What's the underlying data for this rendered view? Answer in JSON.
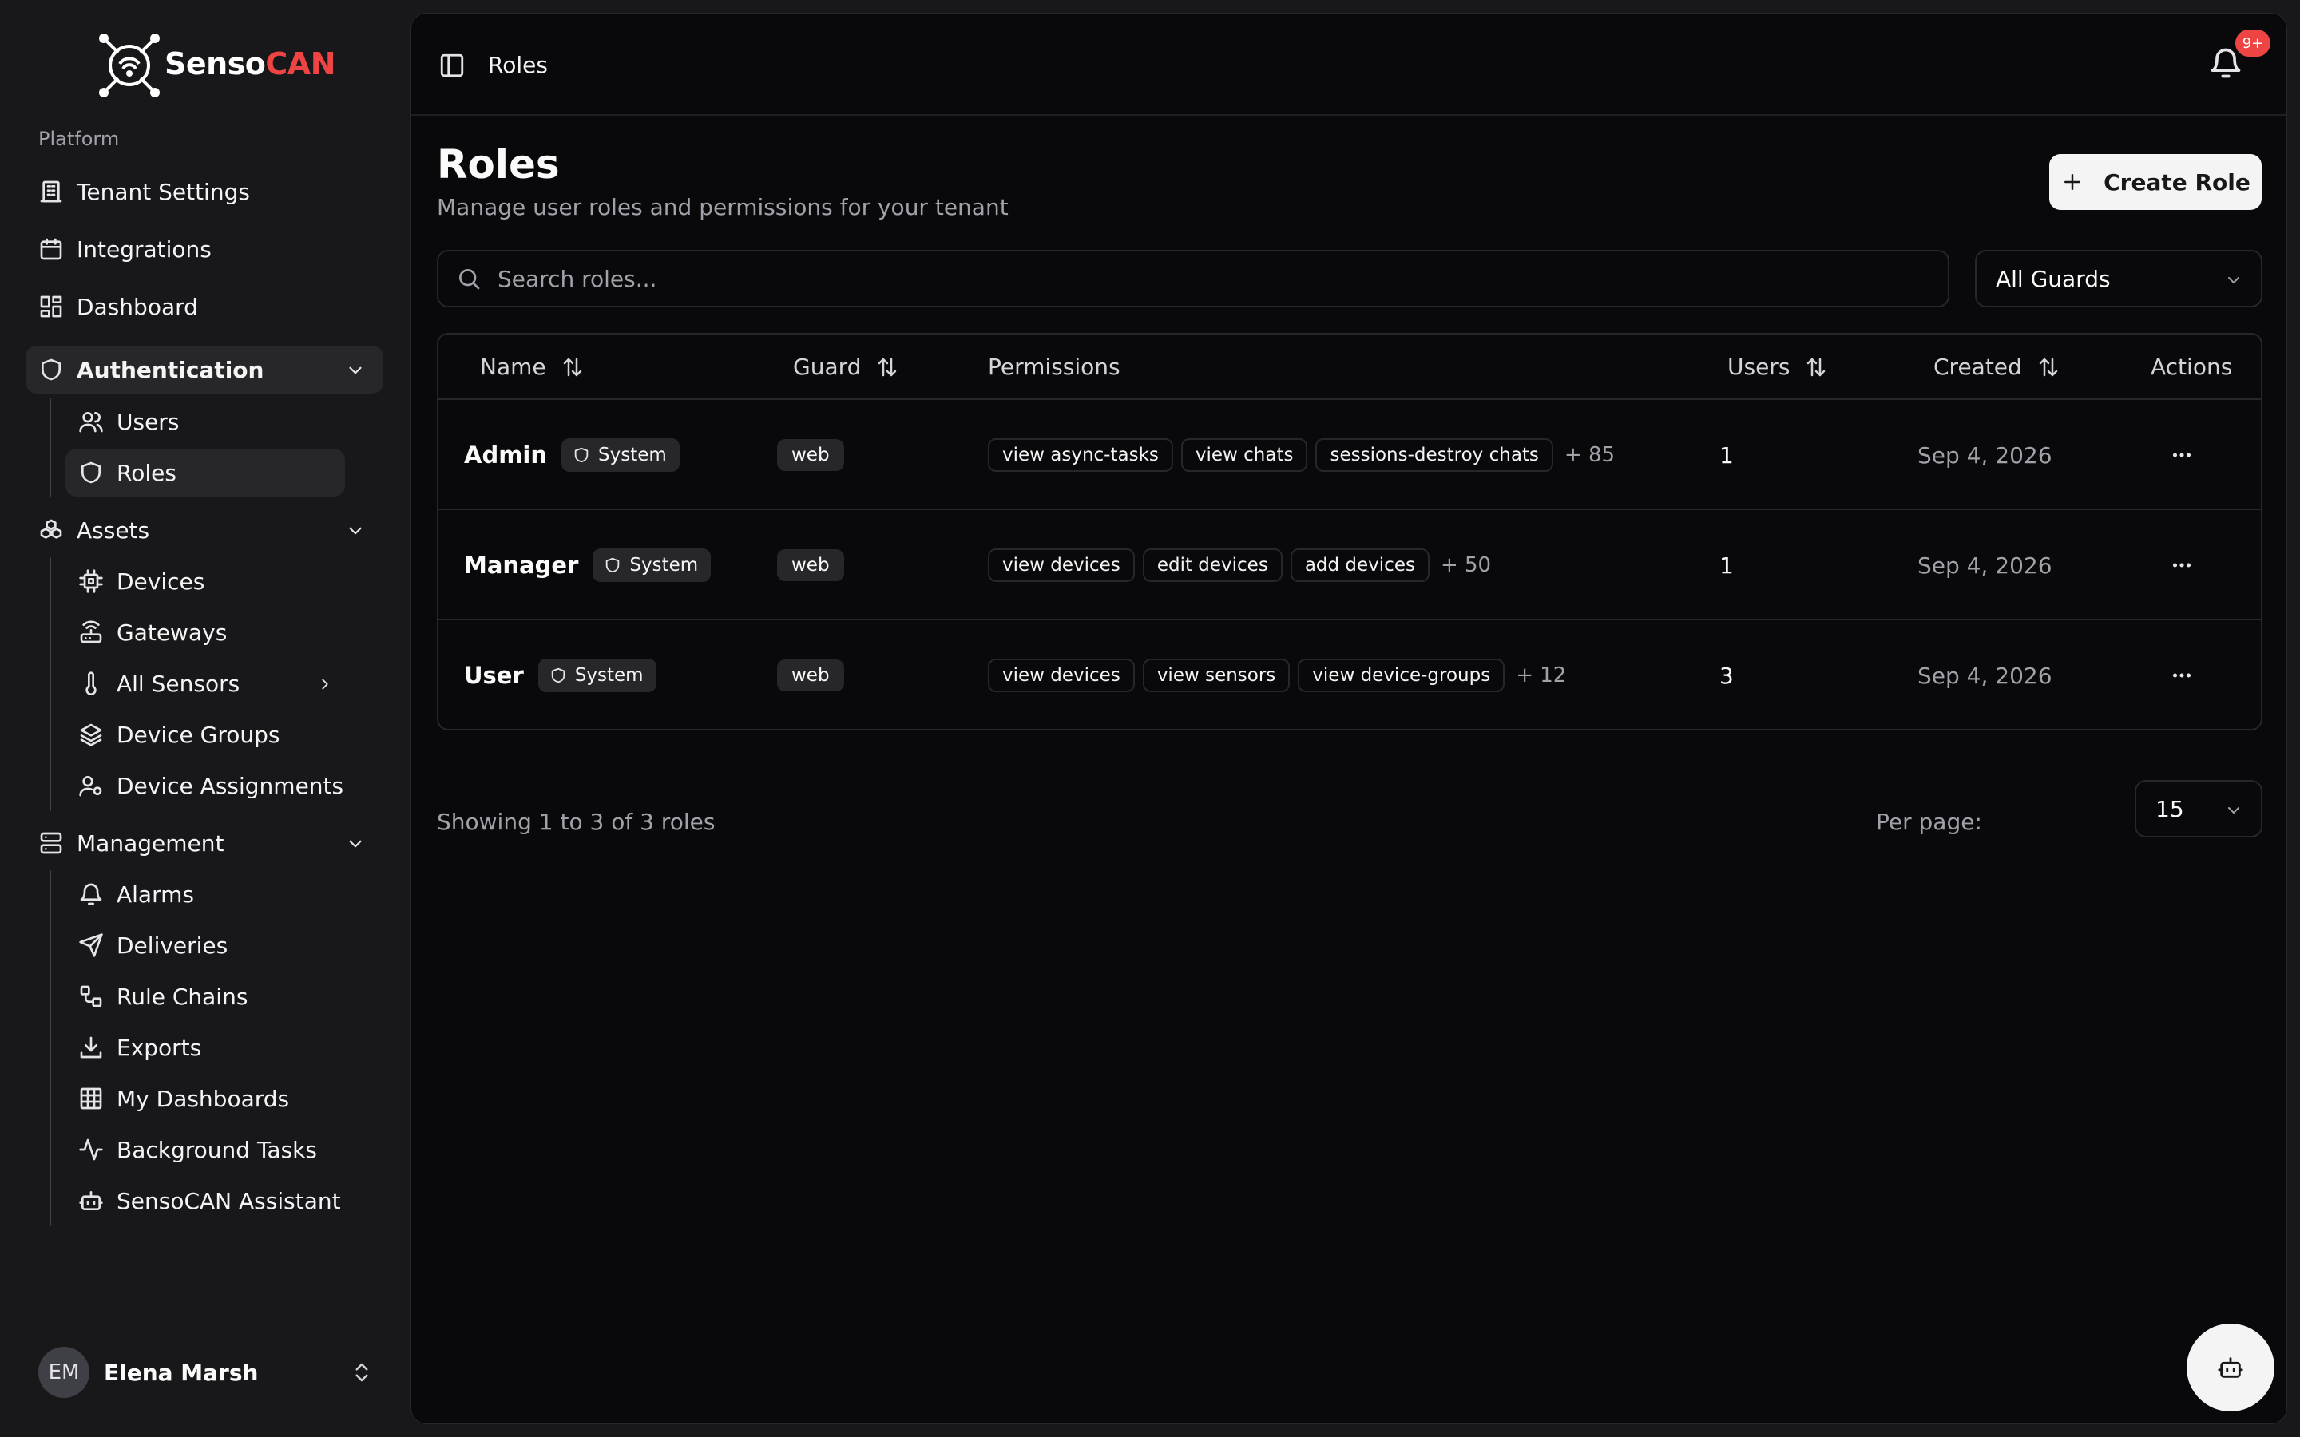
{
  "brand": {
    "name_part1": "Senso",
    "name_part2": "CAN",
    "accent_color": "#ef4444"
  },
  "sidebar": {
    "group_label": "Platform",
    "items": {
      "tenant_settings": "Tenant Settings",
      "integrations": "Integrations",
      "dashboard": "Dashboard",
      "authentication": "Authentication",
      "users": "Users",
      "roles": "Roles",
      "assets": "Assets",
      "devices": "Devices",
      "gateways": "Gateways",
      "all_sensors": "All Sensors",
      "device_groups": "Device Groups",
      "device_assignments": "Device Assignments",
      "management": "Management",
      "alarms": "Alarms",
      "deliveries": "Deliveries",
      "rule_chains": "Rule Chains",
      "exports": "Exports",
      "my_dashboards": "My Dashboards",
      "background_tasks": "Background Tasks",
      "assistant": "SensoCAN Assistant"
    },
    "user": {
      "initials": "EM",
      "name": "Elena Marsh"
    }
  },
  "header": {
    "breadcrumb": "Roles",
    "notification_badge": "9+"
  },
  "page": {
    "title": "Roles",
    "subtitle": "Manage user roles and permissions for your tenant",
    "create_label": "Create Role",
    "search_placeholder": "Search roles...",
    "guard_filter": "All Guards"
  },
  "table": {
    "columns": {
      "name": "Name",
      "guard": "Guard",
      "permissions": "Permissions",
      "users": "Users",
      "created": "Created",
      "actions": "Actions"
    },
    "rows": [
      {
        "name": "Admin",
        "badge": "System",
        "guard": "web",
        "permissions": [
          "view async-tasks",
          "view chats",
          "sessions-destroy chats"
        ],
        "more": "+ 85",
        "users": "1",
        "created": "Sep 4, 2026"
      },
      {
        "name": "Manager",
        "badge": "System",
        "guard": "web",
        "permissions": [
          "view devices",
          "edit devices",
          "add devices"
        ],
        "more": "+ 50",
        "users": "1",
        "created": "Sep 4, 2026"
      },
      {
        "name": "User",
        "badge": "System",
        "guard": "web",
        "permissions": [
          "view devices",
          "view sensors",
          "view device-groups"
        ],
        "more": "+ 12",
        "users": "3",
        "created": "Sep 4, 2026"
      }
    ]
  },
  "footer": {
    "showing": "Showing 1 to 3 of 3 roles",
    "per_page_label": "Per page:",
    "per_page_value": "15"
  }
}
